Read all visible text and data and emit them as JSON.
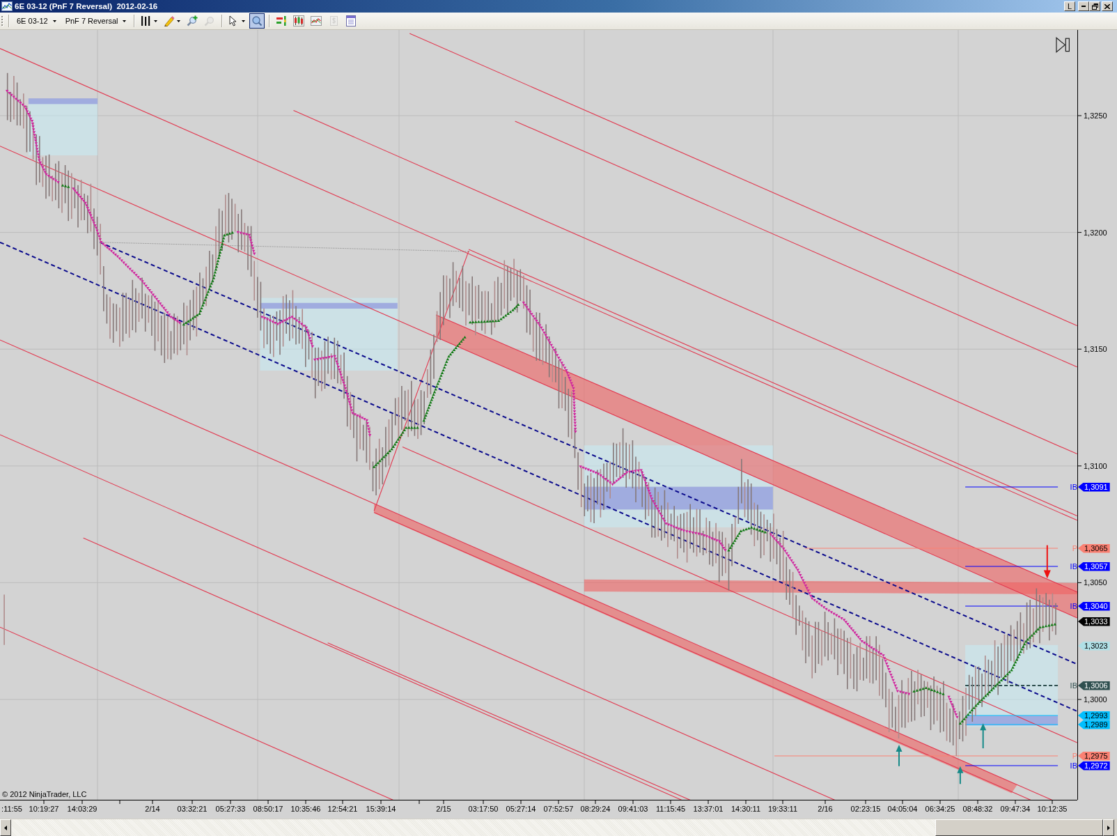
{
  "window": {
    "title": "6E 03-12 (PnF 7 Reversal)  2012-02-16",
    "buttons": [
      {
        "kind": "lock",
        "label": "L"
      },
      {
        "kind": "minimize"
      },
      {
        "kind": "restore"
      },
      {
        "kind": "close"
      }
    ]
  },
  "toolbar": {
    "instrument": "6E 03-12",
    "chart_type": "PnF 7 Reversal",
    "tool_groups": [
      {
        "tools": [
          {
            "kind": "bar-style",
            "dropdown": true,
            "selected": false,
            "disabled": false
          },
          {
            "kind": "draw",
            "dropdown": true,
            "selected": false,
            "disabled": false
          },
          {
            "kind": "zoom-in",
            "dropdown": false,
            "selected": false,
            "disabled": false
          },
          {
            "kind": "zoom-out",
            "dropdown": false,
            "selected": false,
            "disabled": true
          }
        ]
      },
      {
        "tools": [
          {
            "kind": "cursor",
            "dropdown": true,
            "selected": false,
            "disabled": false
          },
          {
            "kind": "magnify",
            "dropdown": false,
            "selected": true,
            "disabled": false
          }
        ]
      },
      {
        "tools": [
          {
            "kind": "strategy",
            "dropdown": false,
            "selected": false,
            "disabled": false
          },
          {
            "kind": "indicators",
            "dropdown": false,
            "selected": false,
            "disabled": false
          },
          {
            "kind": "chart-style",
            "dropdown": false,
            "selected": false,
            "disabled": false
          },
          {
            "kind": "money",
            "dropdown": false,
            "selected": false,
            "disabled": true
          },
          {
            "kind": "properties",
            "dropdown": false,
            "selected": false,
            "disabled": false
          }
        ]
      }
    ]
  },
  "chart": {
    "copyright": "© 2012 NinjaTrader, LLC",
    "price_axis": [
      "1,3250",
      "1,3200",
      "1,3150",
      "1,3100",
      "1,3050",
      "1,3000"
    ],
    "price_markers": [
      {
        "tag": "IB",
        "value": "1,3091",
        "color": "#0000ff"
      },
      {
        "tag": "P",
        "value": "1,3065",
        "color": "#fa8072"
      },
      {
        "tag": "IB",
        "value": "1,3057",
        "color": "#0000ff"
      },
      {
        "tag": "IB",
        "value": "1,3040",
        "color": "#0000ff"
      },
      {
        "value": "1,3033",
        "color": "#000000"
      },
      {
        "value": "1,3023",
        "color": "#b0e0e6"
      },
      {
        "tag": "IB",
        "value": "1,3006",
        "color": "#2f4f4f"
      },
      {
        "value": "1,2993",
        "color": "#00bfff"
      },
      {
        "value": "1,2989",
        "color": "#00bfff"
      },
      {
        "tag": "P",
        "value": "1,2975",
        "color": "#fa8072"
      },
      {
        "tag": "IB",
        "value": "1,2972",
        "color": "#0000ff"
      }
    ],
    "time_axis": [
      ":11:55",
      "10:19:27",
      "14:03:29",
      "2/14",
      "03:32:21",
      "05:27:33",
      "08:50:17",
      "10:35:46",
      "12:54:21",
      "15:39:14",
      "2/15",
      "03:17:50",
      "05:27:14",
      "07:52:57",
      "08:29:24",
      "09:41:03",
      "11:15:45",
      "13:37:01",
      "14:30:11",
      "19:33:11",
      "2/16",
      "02:23:15",
      "04:05:04",
      "06:34:25",
      "08:48:32",
      "09:47:34",
      "10:12:35"
    ]
  }
}
